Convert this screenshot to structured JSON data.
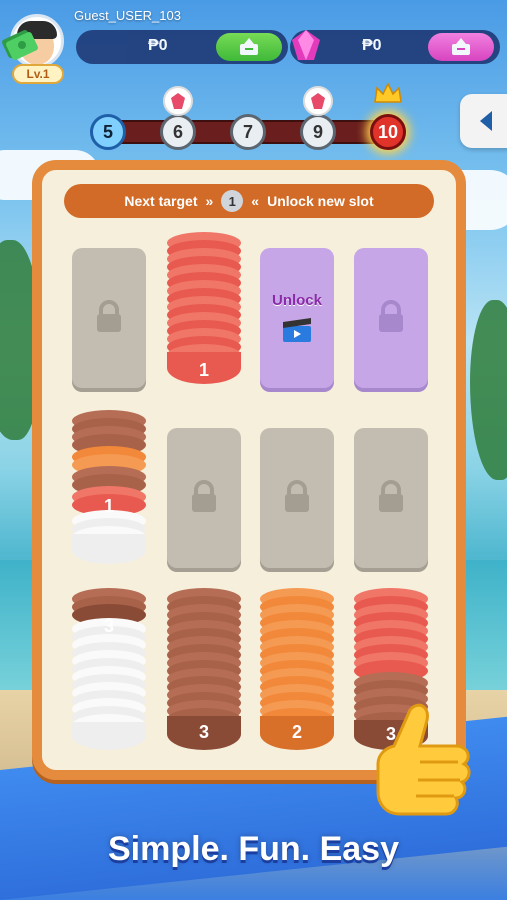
{
  "player": {
    "username": "Guest_USER_103",
    "level_label": "Lv.1"
  },
  "currency": {
    "cash": {
      "value": "₱0",
      "icon": "cash-icon"
    },
    "gems": {
      "value": "₱0",
      "icon": "gem-icon"
    }
  },
  "levels": {
    "nodes": [
      "5",
      "6",
      "7",
      "9",
      "10"
    ],
    "current": "5",
    "final": "10"
  },
  "board": {
    "target_prefix": "Next target",
    "target_value": "1",
    "target_suffix": "Unlock new slot",
    "unlock_label": "Unlock",
    "stacks": {
      "red_top": "1",
      "mixed": "1",
      "white": "3",
      "brown": "3",
      "orange": "2",
      "red_bottom": "3"
    }
  },
  "colors": {
    "board_border": "#e58b3d",
    "board_bg": "#f6efdc",
    "target_bar": "#d26b27",
    "disc_red": "#e85a4f",
    "disc_orange": "#f2883a",
    "disc_brown": "#a9624a",
    "disc_white": "#f3f3f3"
  },
  "tagline": "Simple. Fun. Easy"
}
